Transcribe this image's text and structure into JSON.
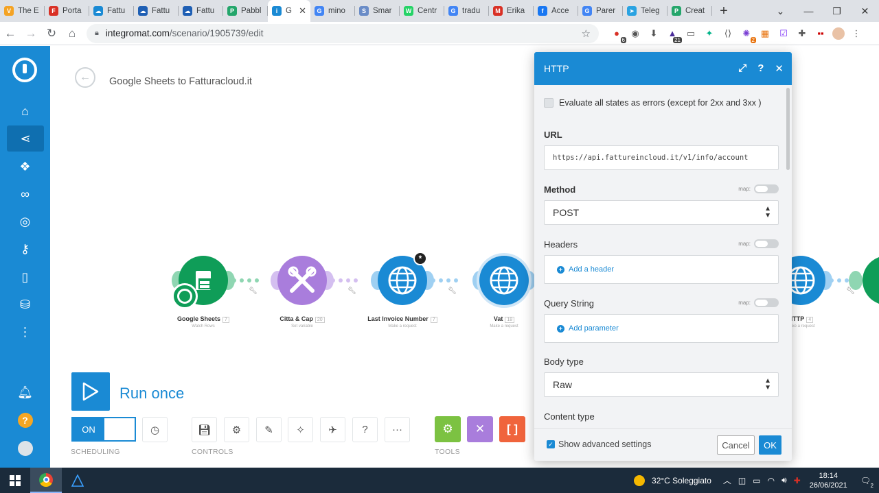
{
  "browser": {
    "tabs": [
      {
        "title": "The E",
        "color": "#f4a324",
        "glyph": "V"
      },
      {
        "title": "Porta",
        "color": "#d93025",
        "glyph": "F"
      },
      {
        "title": "Fattu",
        "color": "#1a8ad4",
        "glyph": "☁"
      },
      {
        "title": "Fattu",
        "color": "#1e5fb4",
        "glyph": "☁"
      },
      {
        "title": "Fattu",
        "color": "#1e5fb4",
        "glyph": "☁"
      },
      {
        "title": "Pabbl",
        "color": "#24a66b",
        "glyph": "P"
      },
      {
        "title": "G",
        "color": "#1a8ad4",
        "glyph": "i",
        "active": true
      },
      {
        "title": "mino",
        "color": "#4285f4",
        "glyph": "G"
      },
      {
        "title": "Smar",
        "color": "#6a8cc7",
        "glyph": "S"
      },
      {
        "title": "Centr",
        "color": "#25d366",
        "glyph": "W"
      },
      {
        "title": "tradu",
        "color": "#4285f4",
        "glyph": "G"
      },
      {
        "title": "Erika",
        "color": "#d93025",
        "glyph": "M"
      },
      {
        "title": "Acce",
        "color": "#1877f2",
        "glyph": "f"
      },
      {
        "title": "Parer",
        "color": "#4285f4",
        "glyph": "G"
      },
      {
        "title": "Teleg",
        "color": "#2aa3e2",
        "glyph": "➤"
      },
      {
        "title": "Creat",
        "color": "#24a66b",
        "glyph": "P"
      }
    ],
    "url_host": "integromat.com",
    "url_path": "/scenario/1905739/edit",
    "ext_badges": {
      "first": "6",
      "second": "21",
      "third": "2"
    }
  },
  "scenario": {
    "title": "Google Sheets to Fatturacloud.it",
    "modules": [
      {
        "name": "Google Sheets",
        "num": "7",
        "sub": "Watch Rows",
        "color": "#0f9d58",
        "ear": "#8fd6b2"
      },
      {
        "name": "Citta & Cap",
        "num": "20",
        "sub": "Set variable",
        "color": "#a97ddc",
        "ear": "#d4bff0"
      },
      {
        "name": "Last Invoice Number",
        "num": "7",
        "sub": "Make a request",
        "color": "#1a8ad4",
        "ear": "#9fd0f2"
      },
      {
        "name": "Vat",
        "num": "18",
        "sub": "Make a request",
        "color": "#1a8ad4",
        "ear": "#9fd0f2"
      },
      {
        "name": "HTTP",
        "num": "4",
        "sub": "Make a request",
        "color": "#1a8ad4",
        "ear": "#9fd0f2"
      }
    ],
    "run_label": "Run once",
    "toggle_label": "ON",
    "scheduling_label": "SCHEDULING",
    "controls_label": "CONTROLS",
    "tools_label": "TOOLS"
  },
  "http_panel": {
    "title": "HTTP",
    "eval_label": "Evaluate all states as errors (except for 2xx and 3xx )",
    "url_label": "URL",
    "url_value": "https://api.fattureincloud.it/v1/info/account",
    "method_label": "Method",
    "method_value": "POST",
    "map_label": "map:",
    "headers_label": "Headers",
    "add_header": "Add a header",
    "query_label": "Query String",
    "add_param": "Add parameter",
    "body_type_label": "Body type",
    "body_type_value": "Raw",
    "content_type_label": "Content type",
    "show_adv": "Show advanced settings",
    "cancel": "Cancel",
    "ok": "OK"
  },
  "taskbar": {
    "weather": "32°C  Soleggiato",
    "time": "18:14",
    "date": "26/06/2021",
    "notif": "2"
  },
  "colors": {
    "accent": "#1a8ad4"
  }
}
